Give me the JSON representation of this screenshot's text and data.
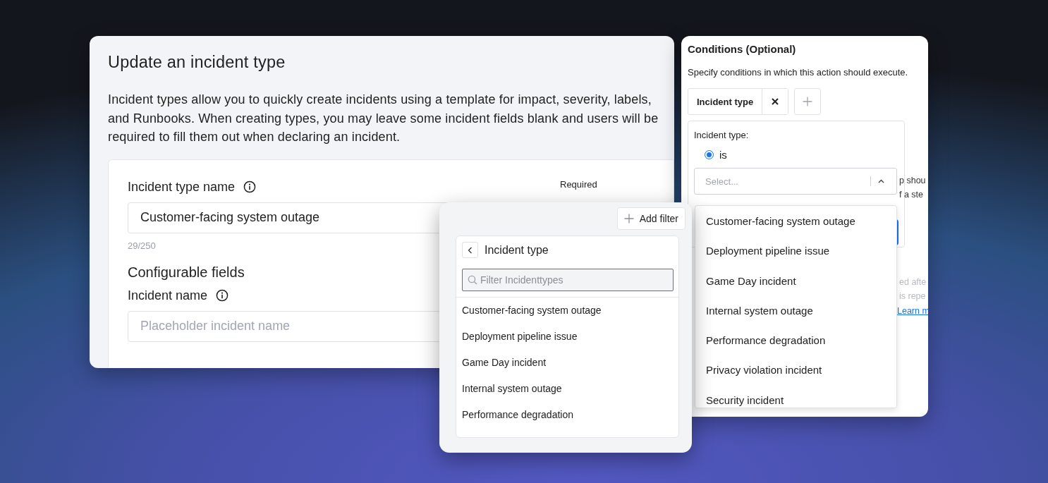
{
  "update_incident_type": {
    "title": "Update an incident type",
    "description": "Incident types allow you to quickly create incidents using a template for impact, severity, labels, and Runbooks. When creating types, you may leave some incident fields blank and users will be required to fill them out when declaring an incident.",
    "name_field": {
      "label": "Incident type name",
      "required": "Required",
      "value": "Customer-facing system outage",
      "counter": "29/250"
    },
    "section_title": "Configurable fields",
    "incident_name_field": {
      "label": "Incident name",
      "placeholder": "Placeholder incident name"
    }
  },
  "filter_popup": {
    "add_filter": "Add filter",
    "title": "Incident type",
    "search": {
      "placeholder": "Filter Incidenttypes"
    },
    "options": [
      "Customer-facing system outage",
      "Deployment pipeline issue",
      "Game Day incident",
      "Internal system outage",
      "Performance degradation"
    ]
  },
  "conditions": {
    "title": "Conditions (Optional)",
    "description": "Specify conditions in which this action should execute.",
    "chip": {
      "label": "Incident type"
    },
    "field_label": "Incident type:",
    "operators": [
      {
        "label": "is",
        "selected": true
      }
    ],
    "select": {
      "placeholder": "Select..."
    },
    "options": [
      "Customer-facing system outage",
      "Deployment pipeline issue",
      "Game Day incident",
      "Internal system outage",
      "Performance degradation",
      "Privacy violation incident",
      "Security incident"
    ],
    "background_fragments": [
      "p shou",
      "f a ste",
      "ed afte",
      "is repe"
    ],
    "learn_more_link": "Learn m"
  }
}
